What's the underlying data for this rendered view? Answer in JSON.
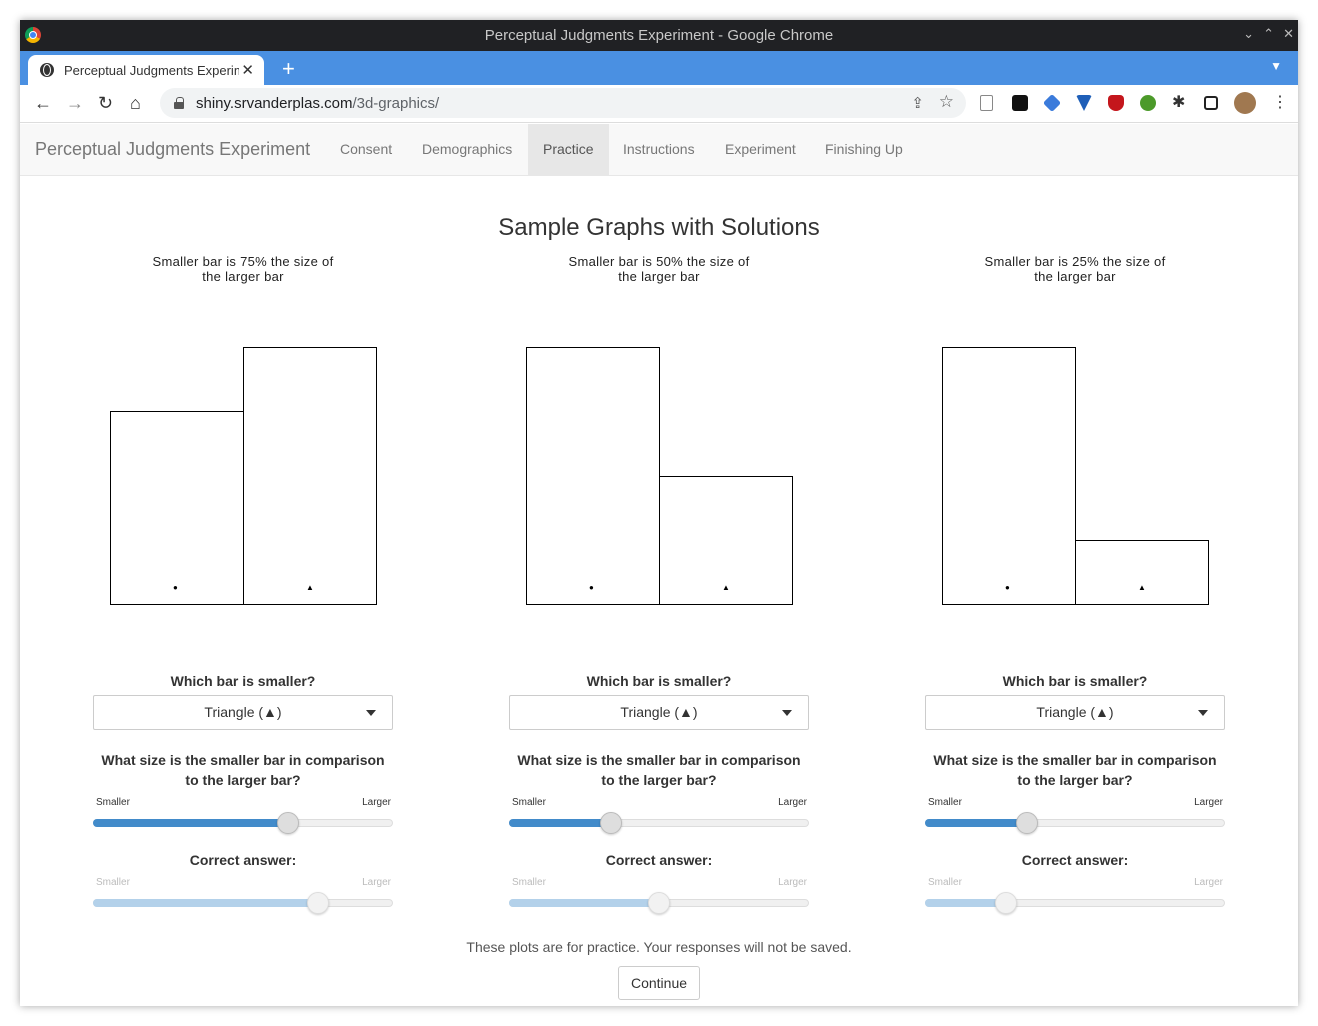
{
  "window": {
    "title": "Perceptual Judgments Experiment - Google Chrome"
  },
  "tab": {
    "title": "Perceptual Judgments Experiment",
    "close": "✕",
    "new_tab": "+"
  },
  "address": {
    "host": "shiny.srvanderplas.com",
    "path": "/3d-graphics/"
  },
  "nav": {
    "brand": "Perceptual Judgments Experiment",
    "items": [
      "Consent",
      "Demographics",
      "Practice",
      "Instructions",
      "Experiment",
      "Finishing Up"
    ],
    "active": "Practice"
  },
  "page": {
    "title": "Sample Graphs with Solutions",
    "note": "These plots are for practice. Your responses will not be saved.",
    "continue_label": "Continue"
  },
  "questions": {
    "which": "Which bar is smaller?",
    "size": "What size is the smaller bar in comparison to the larger bar?",
    "correct": "Correct answer:",
    "smaller_label": "Smaller",
    "larger_label": "Larger"
  },
  "samples": [
    {
      "caption": "Smaller bar is 75% the size of the larger bar",
      "chart_data": {
        "type": "bar",
        "categories": [
          "circle",
          "triangle"
        ],
        "values": [
          75,
          100
        ]
      },
      "selection": "Triangle (▲)",
      "response": 0.65,
      "correct": 0.75
    },
    {
      "caption": "Smaller bar is 50% the size of the larger bar",
      "chart_data": {
        "type": "bar",
        "categories": [
          "circle",
          "triangle"
        ],
        "values": [
          100,
          50
        ]
      },
      "selection": "Triangle (▲)",
      "response": 0.34,
      "correct": 0.5
    },
    {
      "caption": "Smaller bar is 25% the size of the larger bar",
      "chart_data": {
        "type": "bar",
        "categories": [
          "circle",
          "triangle"
        ],
        "values": [
          100,
          25
        ]
      },
      "selection": "Triangle (▲)",
      "response": 0.34,
      "correct": 0.27
    }
  ],
  "chart_data": [
    {
      "type": "bar",
      "categories": [
        "circle",
        "triangle"
      ],
      "values": [
        75,
        100
      ]
    },
    {
      "type": "bar",
      "categories": [
        "circle",
        "triangle"
      ],
      "values": [
        100,
        50
      ]
    },
    {
      "type": "bar",
      "categories": [
        "circle",
        "triangle"
      ],
      "values": [
        100,
        25
      ]
    }
  ]
}
